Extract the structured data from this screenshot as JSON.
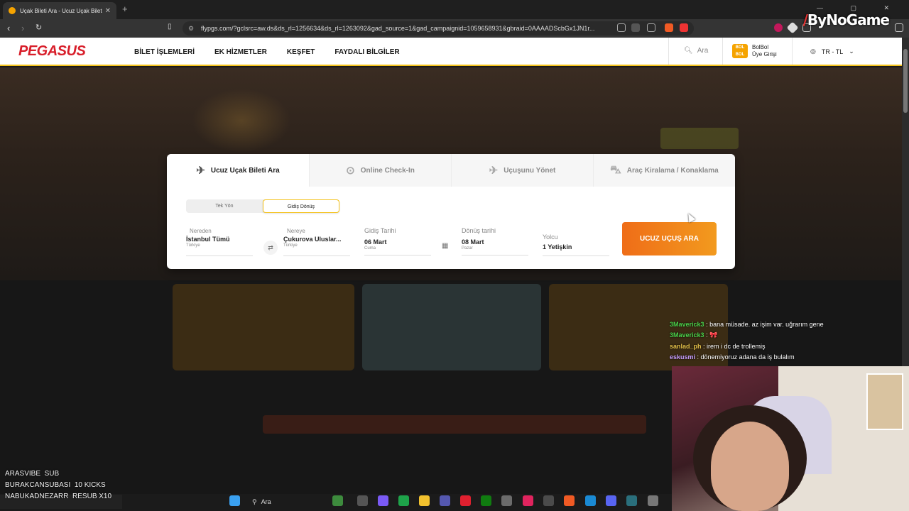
{
  "browser": {
    "tab_title": "Uçak Bileti Ara - Ucuz Uçak Bileti",
    "tab_close": "✕",
    "new_tab": "+",
    "url": "flypgs.com/?gclsrc=aw.ds&ds_rl=1256634&ds_rl=1263092&gad_source=1&gad_campaignid=1059658931&gbraid=0AAAADScbGx1JN1r...",
    "window_controls": "— ▢ ✕"
  },
  "stream_brand": "ByNoGame",
  "header": {
    "logo": "PEGASUS",
    "menu": [
      "BİLET İŞLEMLERİ",
      "EK HİZMETLER",
      "KEŞFET",
      "FAYDALI BİLGİLER"
    ],
    "search_label": "Ara",
    "bolbol_logo": "BOL BOL",
    "bolbol_line1": "BolBol",
    "bolbol_line2": "Üye Girişi",
    "lang": "TR - TL"
  },
  "widget": {
    "tabs": [
      {
        "label": "Ucuz Uçak Bileti Ara",
        "icon": "plane-takeoff-icon"
      },
      {
        "label": "Online Check-In",
        "icon": "location-pin-icon"
      },
      {
        "label": "Uçuşunu Yönet",
        "icon": "plane-icon"
      },
      {
        "label": "Araç Kiralama / Konaklama",
        "icon": "car-icon"
      }
    ],
    "trip_types": [
      "Tek Yön",
      "Gidiş Dönüş"
    ],
    "from": {
      "label": "Nereden",
      "value": "İstanbul Tümü",
      "sub": "Türkiye"
    },
    "to": {
      "label": "Nereye",
      "value": "Çukurova Uluslar...",
      "sub": "Türkiye"
    },
    "departure": {
      "label": "Gidiş Tarihi",
      "value": "06 Mart",
      "sub": "Cuma"
    },
    "return": {
      "label": "Dönüş tarihi",
      "value": "08 Mart",
      "sub": "Pazar"
    },
    "passengers": {
      "label": "Yolcu",
      "value": "1 Yetişkin"
    },
    "cta": "UCUZ UÇUŞ ARA"
  },
  "chat": [
    {
      "user": "3Maverick3",
      "msg": ": bana müsade. az işim var. uğrarım gene",
      "color": "#4bd34b"
    },
    {
      "user": "3Maverick3",
      "msg": ": 🎀",
      "color": "#4bd34b"
    },
    {
      "user": "sanlad_ph",
      "msg": ": irem i dc de trollemiş",
      "color": "#e6c24a"
    },
    {
      "user": "eskusmi",
      "msg": ": dönemiyoruz adana da iş bulalım",
      "color": "#c9a0ff"
    }
  ],
  "alerts": [
    {
      "name": "ARASVIBE",
      "event": "SUB"
    },
    {
      "name": "BURAKCANSUBASI",
      "event": "10 KICKS"
    },
    {
      "name": "NABUKADNEZARR",
      "event": "RESUB X10"
    }
  ],
  "taskbar": {
    "search_label": "Ara"
  }
}
